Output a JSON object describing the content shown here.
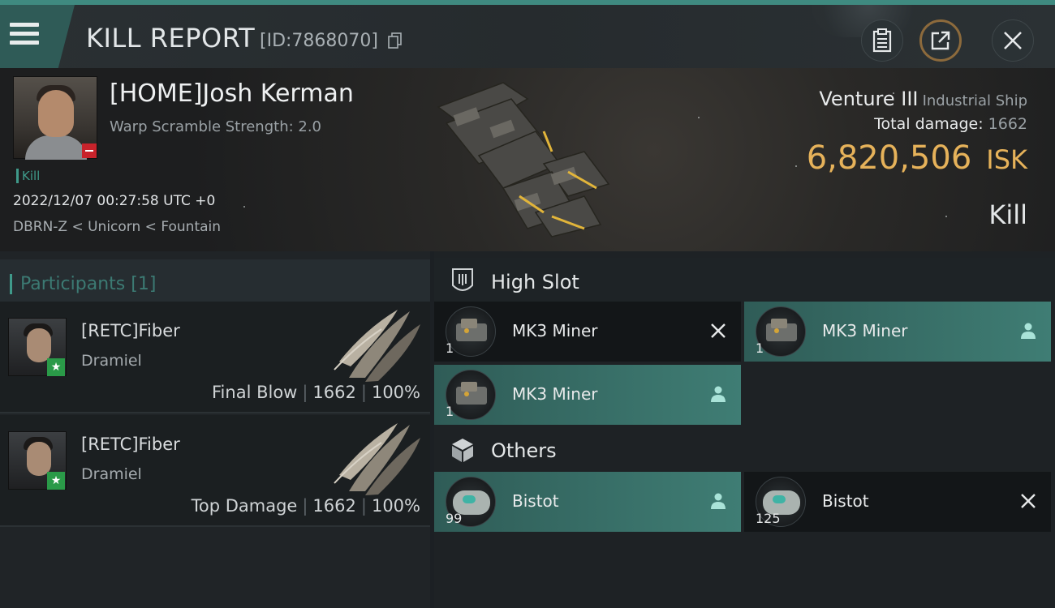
{
  "header": {
    "title": "KILL REPORT",
    "report_id": "[ID:7868070]",
    "buttons": [
      "clipboard-icon",
      "share-icon",
      "close-icon"
    ]
  },
  "victim": {
    "name": "[HOME]Josh Kerman",
    "warp": "Warp Scramble Strength: 2.0",
    "tag": "Kill",
    "datetime": "2022/12/07 00:27:58 UTC +0",
    "location": "DBRN-Z < Unicorn < Fountain",
    "ship_name": "Venture III",
    "ship_class": "Industrial Ship",
    "total_damage_label": "Total damage:",
    "total_damage": "1662",
    "isk_value": "6,820,506",
    "isk_unit": "ISK",
    "result": "Kill"
  },
  "participants": {
    "label": "Participants",
    "count": "[1]",
    "rows": [
      {
        "name": "[RETC]Fiber",
        "ship": "Dramiel",
        "role": "Final Blow",
        "damage": "1662",
        "percent": "100%"
      },
      {
        "name": "[RETC]Fiber",
        "ship": "Dramiel",
        "role": "Top Damage",
        "damage": "1662",
        "percent": "100%"
      }
    ]
  },
  "high_slot": {
    "label": "High Slot",
    "items": [
      {
        "qty": "1",
        "name": "MK3 Miner",
        "status": "destroyed"
      },
      {
        "qty": "1",
        "name": "MK3 Miner",
        "status": "dropped"
      },
      {
        "qty": "1",
        "name": "MK3 Miner",
        "status": "dropped"
      }
    ]
  },
  "others": {
    "label": "Others",
    "items": [
      {
        "qty": "99",
        "name": "Bistot",
        "status": "dropped"
      },
      {
        "qty": "125",
        "name": "Bistot",
        "status": "destroyed"
      }
    ]
  },
  "colors": {
    "accent_teal": "#3f9a8a",
    "isk_gold": "#e6b25a",
    "kill_red": "#c8232b",
    "ally_green": "#2a9a48"
  }
}
